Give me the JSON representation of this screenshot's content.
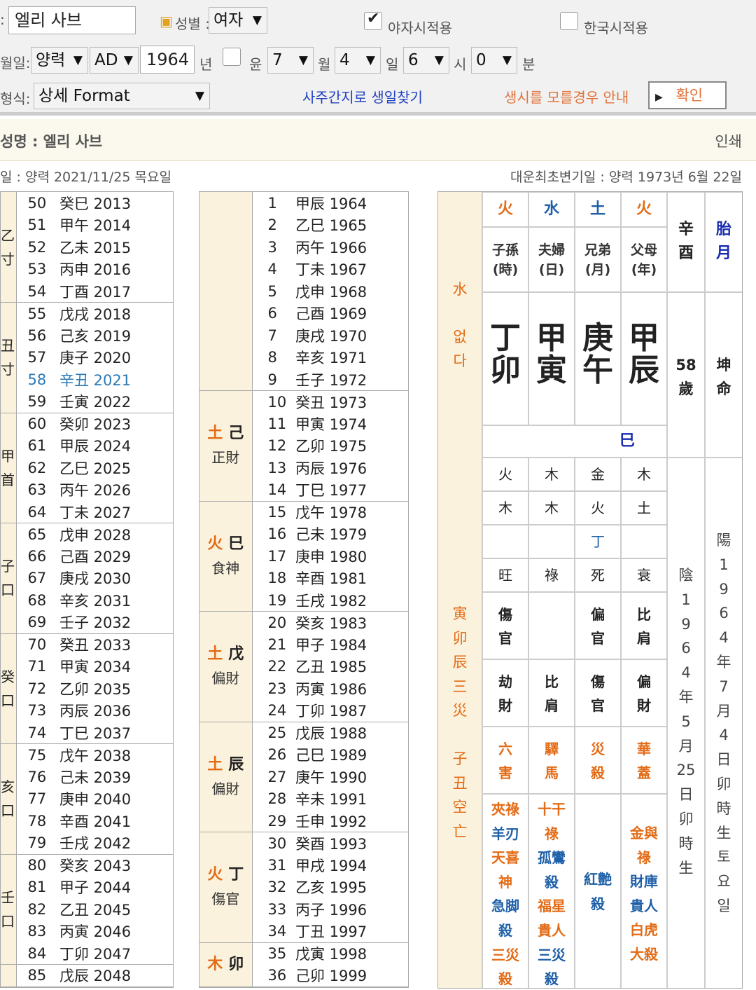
{
  "form": {
    "name_value": "엘리 사브",
    "gender_label": "성별 :",
    "gender_value": "여자",
    "night_label": "야자시적용",
    "korea_label": "한국시적용",
    "birth_label": "월일:",
    "cal_value": "양력",
    "era_value": "AD",
    "year_value": "1964",
    "year_unit": "년",
    "leap_label": "윤",
    "month_value": "7",
    "month_unit": "월",
    "day_value": "4",
    "day_unit": "일",
    "hour_value": "6",
    "hour_unit": "시",
    "min_value": "0",
    "min_unit": "분",
    "format_label": "형식:",
    "format_value": "상세 Format",
    "link_saju": "사주간지로 생일찾기",
    "link_unknown": "생시를 모를경우 안내",
    "confirm_label": "확인"
  },
  "header": {
    "name": "성명 : 엘리 사브",
    "print": "인쇄",
    "today": "일 : 양력 2021/11/25 목요일",
    "daeun": "대운최초변기일 : 양력 1973년 6월 22일"
  },
  "left_groups": [
    {
      "label": "乙\n寸",
      "rows": [
        [
          "50",
          "癸巳 2013"
        ],
        [
          "51",
          "甲午 2014"
        ],
        [
          "52",
          "乙未 2015"
        ],
        [
          "53",
          "丙申 2016"
        ],
        [
          "54",
          "丁酉 2017"
        ]
      ]
    },
    {
      "label": "丑\n寸",
      "rows": [
        [
          "55",
          "戊戌 2018"
        ],
        [
          "56",
          "己亥 2019"
        ],
        [
          "57",
          "庚子 2020"
        ],
        [
          "58",
          "辛丑 2021"
        ],
        [
          "59",
          "壬寅 2022"
        ]
      ]
    },
    {
      "label": "甲\n首",
      "rows": [
        [
          "60",
          "癸卯 2023"
        ],
        [
          "61",
          "甲辰 2024"
        ],
        [
          "62",
          "乙巳 2025"
        ],
        [
          "63",
          "丙午 2026"
        ],
        [
          "64",
          "丁未 2027"
        ]
      ]
    },
    {
      "label": "子\n口",
      "rows": [
        [
          "65",
          "戊申 2028"
        ],
        [
          "66",
          "己酉 2029"
        ],
        [
          "67",
          "庚戌 2030"
        ],
        [
          "68",
          "辛亥 2031"
        ],
        [
          "69",
          "壬子 2032"
        ]
      ]
    },
    {
      "label": "癸\n口",
      "rows": [
        [
          "70",
          "癸丑 2033"
        ],
        [
          "71",
          "甲寅 2034"
        ],
        [
          "72",
          "乙卯 2035"
        ],
        [
          "73",
          "丙辰 2036"
        ],
        [
          "74",
          "丁巳 2037"
        ]
      ]
    },
    {
      "label": "亥\n口",
      "rows": [
        [
          "75",
          "戊午 2038"
        ],
        [
          "76",
          "己未 2039"
        ],
        [
          "77",
          "庚申 2040"
        ],
        [
          "78",
          "辛酉 2041"
        ],
        [
          "79",
          "壬戌 2042"
        ]
      ]
    },
    {
      "label": "壬\n口",
      "rows": [
        [
          "80",
          "癸亥 2043"
        ],
        [
          "81",
          "甲子 2044"
        ],
        [
          "82",
          "乙丑 2045"
        ],
        [
          "83",
          "丙寅 2046"
        ],
        [
          "84",
          "丁卯 2047"
        ]
      ]
    },
    {
      "label": "",
      "rows": [
        [
          "85",
          "戊辰 2048"
        ]
      ]
    }
  ],
  "highlight_age": "58",
  "mid_groups": [
    {
      "el": "",
      "ch": "",
      "sub": "",
      "rows": [
        [
          "1",
          "甲辰 1964"
        ],
        [
          "2",
          "乙巳 1965"
        ],
        [
          "3",
          "丙午 1966"
        ],
        [
          "4",
          "丁未 1967"
        ],
        [
          "5",
          "戊申 1968"
        ],
        [
          "6",
          "己酉 1969"
        ],
        [
          "7",
          "庚戌 1970"
        ],
        [
          "8",
          "辛亥 1971"
        ],
        [
          "9",
          "壬子 1972"
        ]
      ]
    },
    {
      "el": "土",
      "ch": "己",
      "sub": "正財",
      "rows": [
        [
          "10",
          "癸丑 1973"
        ],
        [
          "11",
          "甲寅 1974"
        ],
        [
          "12",
          "乙卯 1975"
        ],
        [
          "13",
          "丙辰 1976"
        ],
        [
          "14",
          "丁巳 1977"
        ]
      ]
    },
    {
      "el": "火",
      "ch": "巳",
      "sub": "食神",
      "rows": [
        [
          "15",
          "戊午 1978"
        ],
        [
          "16",
          "己未 1979"
        ],
        [
          "17",
          "庚申 1980"
        ],
        [
          "18",
          "辛酉 1981"
        ],
        [
          "19",
          "壬戌 1982"
        ]
      ]
    },
    {
      "el": "土",
      "ch": "戊",
      "sub": "偏財",
      "rows": [
        [
          "20",
          "癸亥 1983"
        ],
        [
          "21",
          "甲子 1984"
        ],
        [
          "22",
          "乙丑 1985"
        ],
        [
          "23",
          "丙寅 1986"
        ],
        [
          "24",
          "丁卯 1987"
        ]
      ]
    },
    {
      "el": "土",
      "ch": "辰",
      "sub": "偏財",
      "rows": [
        [
          "25",
          "戊辰 1988"
        ],
        [
          "26",
          "己巳 1989"
        ],
        [
          "27",
          "庚午 1990"
        ],
        [
          "28",
          "辛未 1991"
        ],
        [
          "29",
          "壬申 1992"
        ]
      ]
    },
    {
      "el": "火",
      "ch": "丁",
      "sub": "傷官",
      "rows": [
        [
          "30",
          "癸酉 1993"
        ],
        [
          "31",
          "甲戌 1994"
        ],
        [
          "32",
          "乙亥 1995"
        ],
        [
          "33",
          "丙子 1996"
        ],
        [
          "34",
          "丁丑 1997"
        ]
      ]
    },
    {
      "el": "木",
      "ch": "卯",
      "sub": "",
      "rows": [
        [
          "35",
          "戊寅 1998"
        ],
        [
          "36",
          "己卯 1999"
        ]
      ]
    }
  ],
  "chart": {
    "elements": [
      "火",
      "水",
      "土",
      "火"
    ],
    "roles": [
      "子孫\n(時)",
      "夫婦\n(日)",
      "兄弟\n(月)",
      "父母\n(年)"
    ],
    "stems": [
      "丁",
      "甲",
      "庚",
      "甲"
    ],
    "branches": [
      "卯",
      "寅",
      "午",
      "辰"
    ],
    "year_pillar": "辛\n酉",
    "tai_label": "胎\n月",
    "age": "58\n歲",
    "gender": "坤\n命",
    "water_note": "水\n\n없\n다",
    "hidden": "巳",
    "r_el1": [
      "火",
      "木",
      "金",
      "木"
    ],
    "r_el2": [
      "木",
      "木",
      "火",
      "土"
    ],
    "r_el3": [
      "",
      "",
      "丁",
      ""
    ],
    "stages": [
      "旺",
      "祿",
      "死",
      "衰"
    ],
    "ten_top": [
      "傷\n官",
      "",
      "偏\n官",
      "比\n肩"
    ],
    "ten_bot": [
      "劫\n財",
      "比\n肩",
      "傷\n官",
      "偏\n財"
    ],
    "spirits1": [
      "六\n害",
      "驛\n馬",
      "災\n殺",
      "華\n蓋"
    ],
    "c_col1": "夾祿\n羊刃\n天喜\n神\n急脚\n殺\n三災\n殺",
    "c_col2": "十干\n祿\n孤鸞\n殺\n福星\n貴人\n三災\n殺",
    "c_col3": "紅艶\n殺",
    "c_col4": "金與\n祿\n財庫\n貴人\n白虎\n大殺",
    "side_note": "寅\n卯\n辰\n三\n災\n\n子\n丑\n空\n亡",
    "lunar": "陰\n1\n9\n6\n4\n年\n5\n月\n25\n日\n卯\n時\n生",
    "solar": "陽\n1\n9\n6\n4\n年\n7\n月\n4\n日\n卯\n時\n生\n토\n요\n일"
  }
}
